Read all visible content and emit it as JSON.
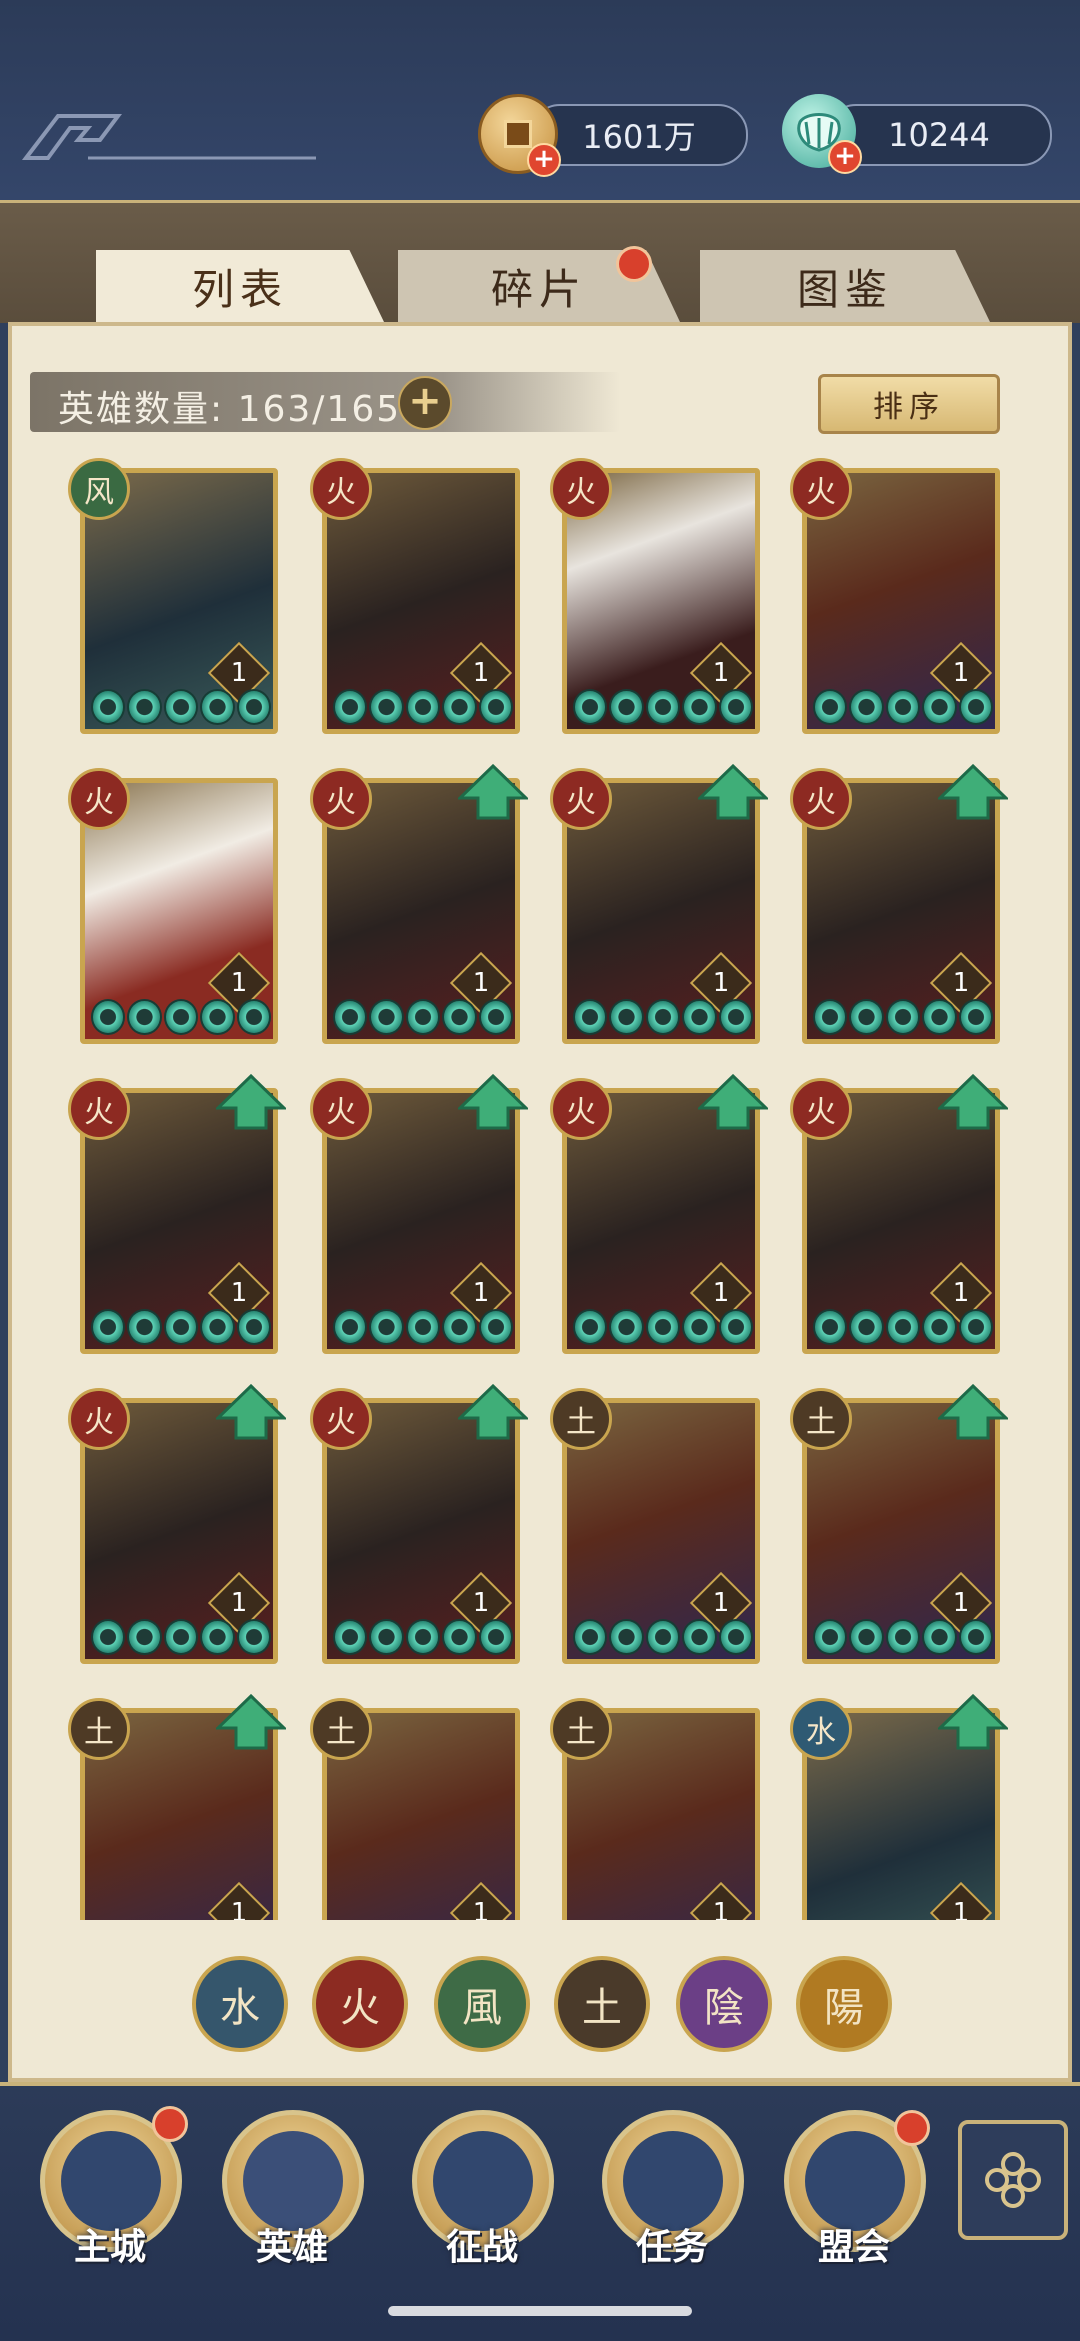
{
  "resources": {
    "coins": "1601万",
    "shells": "10244"
  },
  "tabs": [
    {
      "label": "列表",
      "active": true
    },
    {
      "label": "碎片",
      "active": false,
      "notification": true
    },
    {
      "label": "图鉴",
      "active": false
    }
  ],
  "hero_count": "英雄数量: 163/165",
  "sort_label": "排序",
  "heroes": [
    {
      "element": "风",
      "level": "1",
      "upgrade": false
    },
    {
      "element": "火",
      "level": "1",
      "upgrade": false
    },
    {
      "element": "火",
      "level": "1",
      "upgrade": false
    },
    {
      "element": "火",
      "level": "1",
      "upgrade": false
    },
    {
      "element": "火",
      "level": "1",
      "upgrade": false
    },
    {
      "element": "火",
      "level": "1",
      "upgrade": true
    },
    {
      "element": "火",
      "level": "1",
      "upgrade": true
    },
    {
      "element": "火",
      "level": "1",
      "upgrade": true
    },
    {
      "element": "火",
      "level": "1",
      "upgrade": true
    },
    {
      "element": "火",
      "level": "1",
      "upgrade": true
    },
    {
      "element": "火",
      "level": "1",
      "upgrade": true
    },
    {
      "element": "火",
      "level": "1",
      "upgrade": true
    },
    {
      "element": "火",
      "level": "1",
      "upgrade": true
    },
    {
      "element": "火",
      "level": "1",
      "upgrade": true
    },
    {
      "element": "土",
      "level": "1",
      "upgrade": false
    },
    {
      "element": "土",
      "level": "1",
      "upgrade": true
    },
    {
      "element": "土",
      "level": "1",
      "upgrade": true
    },
    {
      "element": "土",
      "level": "1",
      "upgrade": false
    },
    {
      "element": "土",
      "level": "1",
      "upgrade": false
    },
    {
      "element": "水",
      "level": "1",
      "upgrade": true
    }
  ],
  "element_filters": [
    "水",
    "火",
    "風",
    "土",
    "陰",
    "陽"
  ],
  "nav": [
    {
      "label": "主城",
      "notification": true
    },
    {
      "label": "英雄",
      "notification": false
    },
    {
      "label": "征战",
      "notification": false
    },
    {
      "label": "任务",
      "notification": false
    },
    {
      "label": "盟会",
      "notification": true
    }
  ],
  "colors": {
    "accent_gold": "#c9a54f",
    "panel_bg": "#efe8d4",
    "header_bg": "#2c3b58",
    "upgrade_green": "#3fae78"
  }
}
